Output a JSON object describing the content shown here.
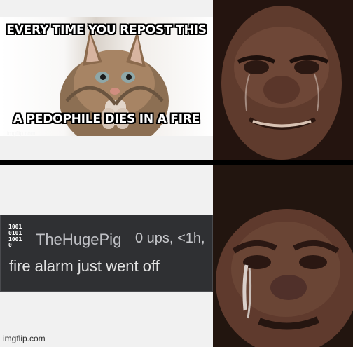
{
  "meme": {
    "top_text": "EVERY TIME YOU REPOST THIS",
    "bottom_text": "A PEDOPHILE DIES IN A FIRE",
    "small_credit": "imgflip.com"
  },
  "comment": {
    "username": "TheHugePig",
    "meta": "0 ups, <1h,",
    "body": "fire alarm just went off",
    "avatar_icon": "binary-avatar-icon"
  },
  "footer": {
    "watermark": "imgflip.com"
  },
  "colors": {
    "panel_bg": "#f1f1f1",
    "comment_bg": "#2f3033",
    "comment_text": "#e3e3e3",
    "divider": "#000000"
  }
}
